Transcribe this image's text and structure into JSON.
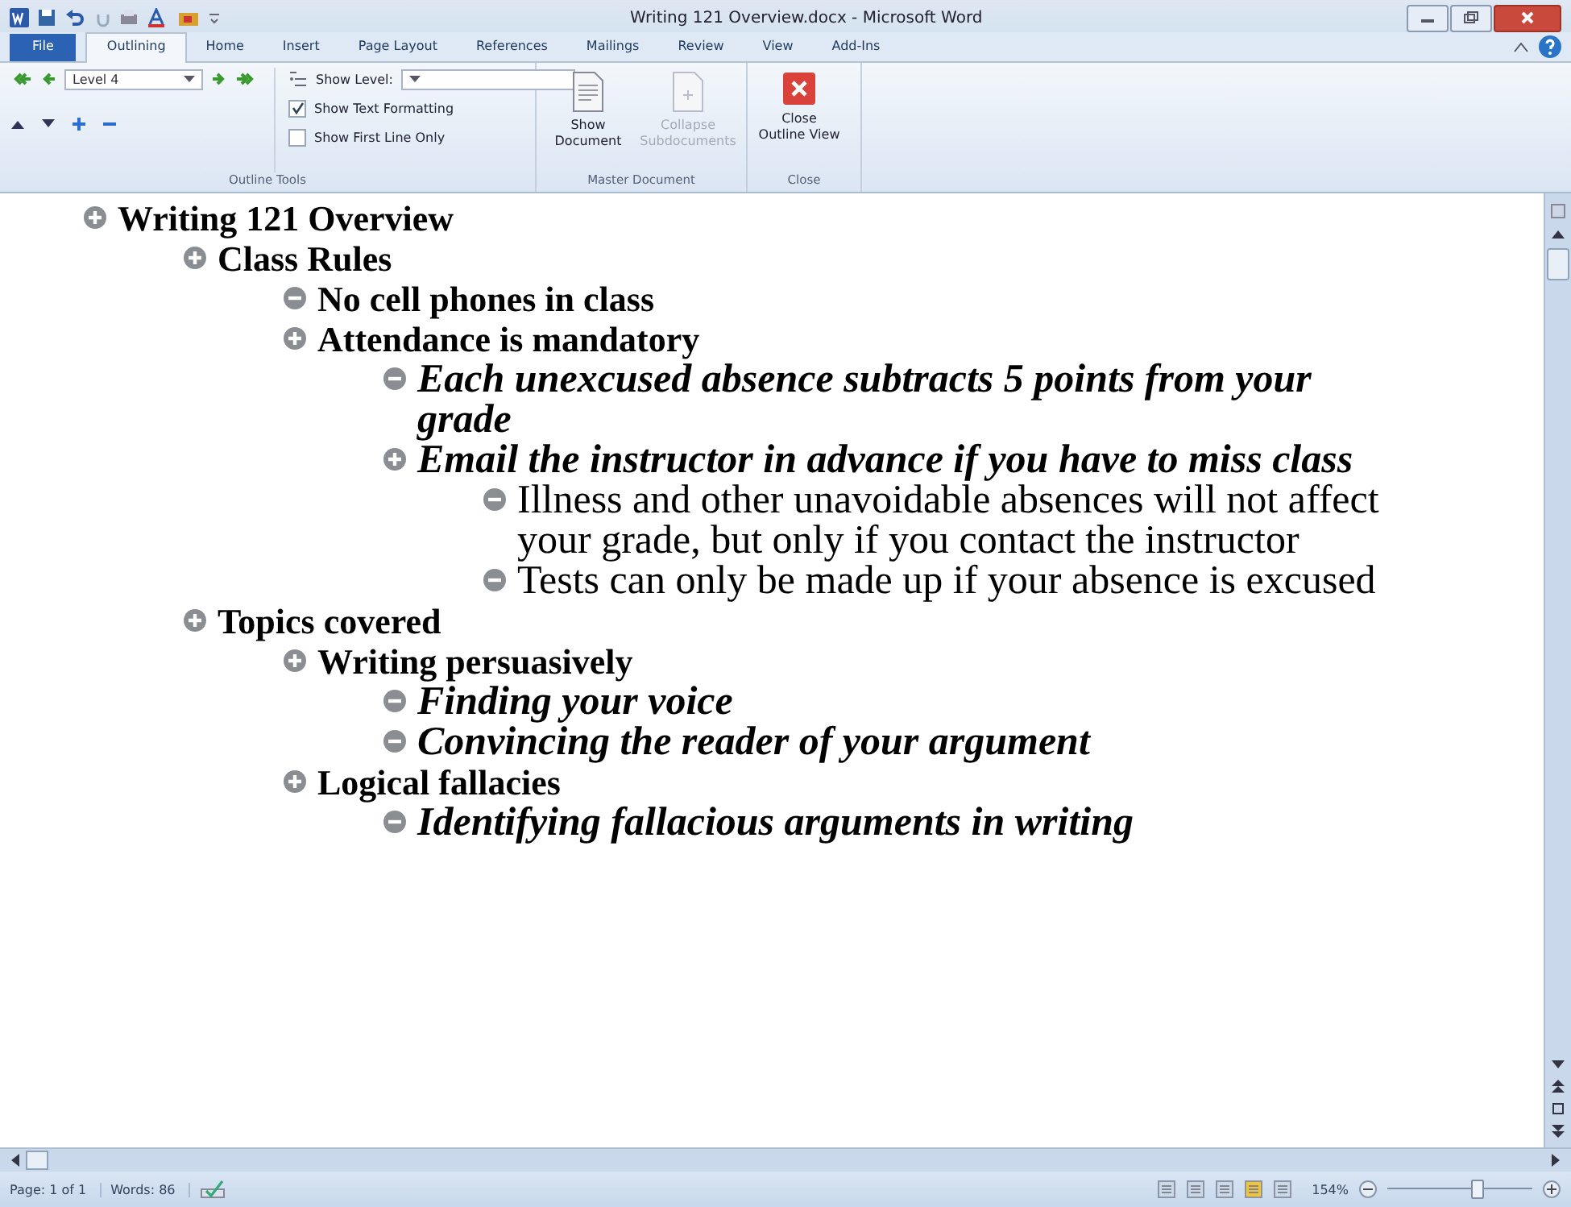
{
  "window": {
    "title": "Writing 121 Overview.docx - Microsoft Word"
  },
  "tabs": [
    {
      "label": "File",
      "kind": "file",
      "selected": false
    },
    {
      "label": "Outlining",
      "kind": "tab",
      "selected": true
    },
    {
      "label": "Home",
      "kind": "tab",
      "selected": false
    },
    {
      "label": "Insert",
      "kind": "tab",
      "selected": false
    },
    {
      "label": "Page Layout",
      "kind": "tab",
      "selected": false
    },
    {
      "label": "References",
      "kind": "tab",
      "selected": false
    },
    {
      "label": "Mailings",
      "kind": "tab",
      "selected": false
    },
    {
      "label": "Review",
      "kind": "tab",
      "selected": false
    },
    {
      "label": "View",
      "kind": "tab",
      "selected": false
    },
    {
      "label": "Add-Ins",
      "kind": "tab",
      "selected": false
    }
  ],
  "ribbon": {
    "outline_tools": {
      "level": "Level 4",
      "show_level_label": "Show Level:",
      "checkboxes": [
        {
          "label": "Show Text Formatting",
          "checked": true
        },
        {
          "label": "Show First Line Only",
          "checked": false
        }
      ],
      "group_label": "Outline Tools"
    },
    "master_document": {
      "buttons": [
        {
          "label": "Show Document",
          "disabled": false
        },
        {
          "label": "Collapse Subdocuments",
          "disabled": true
        }
      ],
      "group_label": "Master Document"
    },
    "close": {
      "button": "Close Outline View",
      "group_label": "Close"
    }
  },
  "outline": [
    {
      "text": "Writing 121 Overview",
      "kind": "bold",
      "expandable": true,
      "children": [
        {
          "text": "Class Rules",
          "kind": "bold",
          "expandable": true,
          "children": [
            {
              "text": "No cell phones in class",
              "kind": "bold",
              "expandable": false
            },
            {
              "text": "Attendance is mandatory",
              "kind": "bold",
              "expandable": true,
              "children": [
                {
                  "text": "Each unexcused absence subtracts 5 points from your grade",
                  "kind": "italic",
                  "expandable": false
                },
                {
                  "text": "Email the instructor in advance if you have to miss class",
                  "kind": "italic",
                  "expandable": true,
                  "children": [
                    {
                      "text": "Illness and other unavoidable absences will not affect your grade, but only if you contact the instructor",
                      "kind": "plain",
                      "expandable": false
                    },
                    {
                      "text": "Tests can only be made up if your absence is excused",
                      "kind": "plain",
                      "expandable": false
                    }
                  ]
                }
              ]
            }
          ]
        },
        {
          "text": "Topics covered",
          "kind": "bold",
          "expandable": true,
          "children": [
            {
              "text": "Writing persuasively",
              "kind": "bold",
              "expandable": true,
              "children": [
                {
                  "text": "Finding your voice",
                  "kind": "italic",
                  "expandable": false
                },
                {
                  "text": "Convincing the reader of your argument",
                  "kind": "italic",
                  "expandable": false
                }
              ]
            },
            {
              "text": "Logical fallacies",
              "kind": "bold",
              "expandable": true,
              "children": [
                {
                  "text": "Identifying fallacious arguments in writing",
                  "kind": "italic",
                  "expandable": false
                }
              ]
            }
          ]
        }
      ]
    }
  ],
  "status_bar": {
    "page": "Page: 1 of 1",
    "words": "Words: 86",
    "zoom": "154%",
    "zoom_slider": {
      "level": 0.62
    }
  }
}
